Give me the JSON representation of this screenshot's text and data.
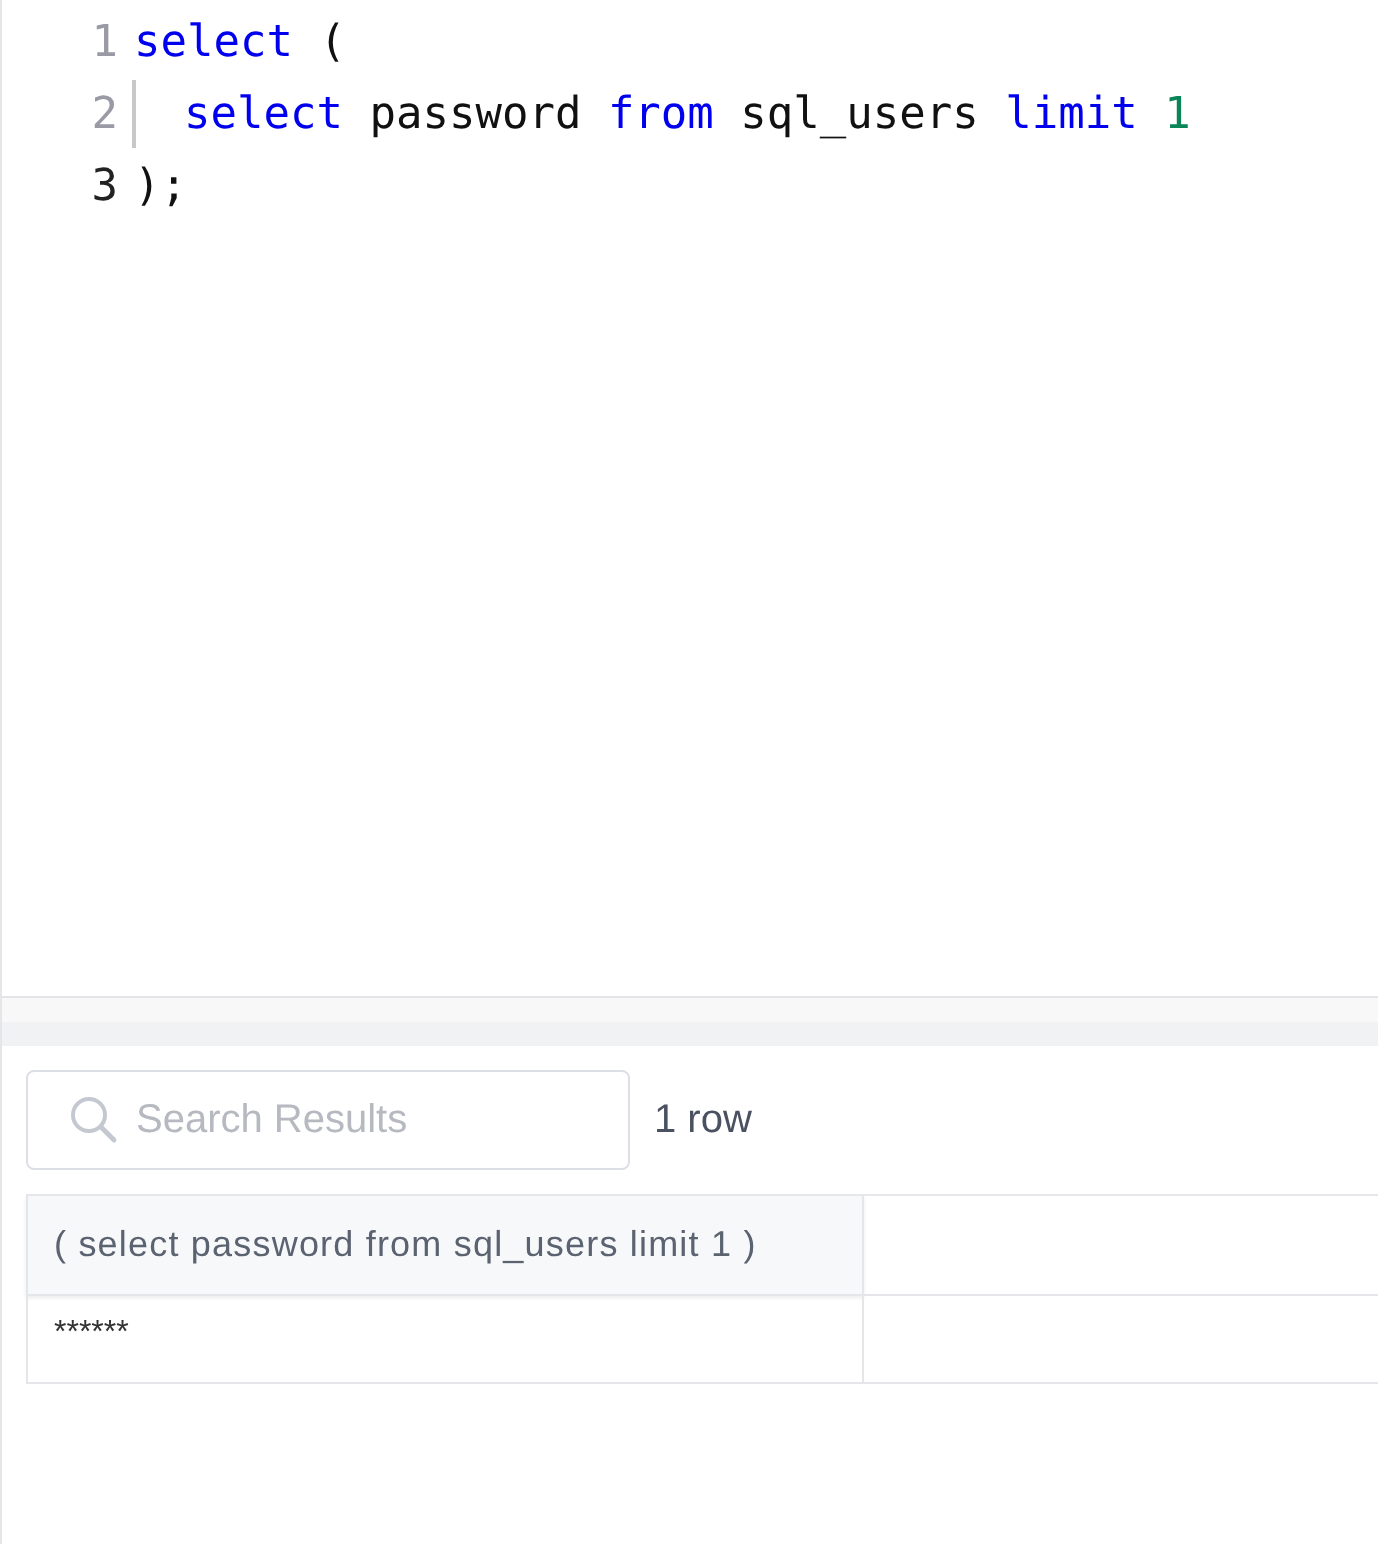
{
  "editor": {
    "lines": [
      {
        "number": "1",
        "current": false,
        "indent_guide": false,
        "tokens": [
          {
            "text": "select",
            "kind": "keyword"
          },
          {
            "text": " (",
            "kind": "plain"
          }
        ]
      },
      {
        "number": "2",
        "current": false,
        "indent_guide": true,
        "tokens": [
          {
            "text": "select",
            "kind": "keyword"
          },
          {
            "text": " password ",
            "kind": "plain"
          },
          {
            "text": "from",
            "kind": "keyword"
          },
          {
            "text": " sql_users ",
            "kind": "plain"
          },
          {
            "text": "limit",
            "kind": "keyword"
          },
          {
            "text": " 1",
            "kind": "number"
          }
        ]
      },
      {
        "number": "3",
        "current": true,
        "indent_guide": false,
        "tokens": [
          {
            "text": ");",
            "kind": "plain"
          }
        ]
      }
    ]
  },
  "results": {
    "search": {
      "placeholder": "Search Results"
    },
    "row_count": "1 row",
    "table": {
      "columns": [
        "( select password from sql_users limit 1 )"
      ],
      "rows": [
        [
          "******"
        ]
      ]
    }
  }
}
